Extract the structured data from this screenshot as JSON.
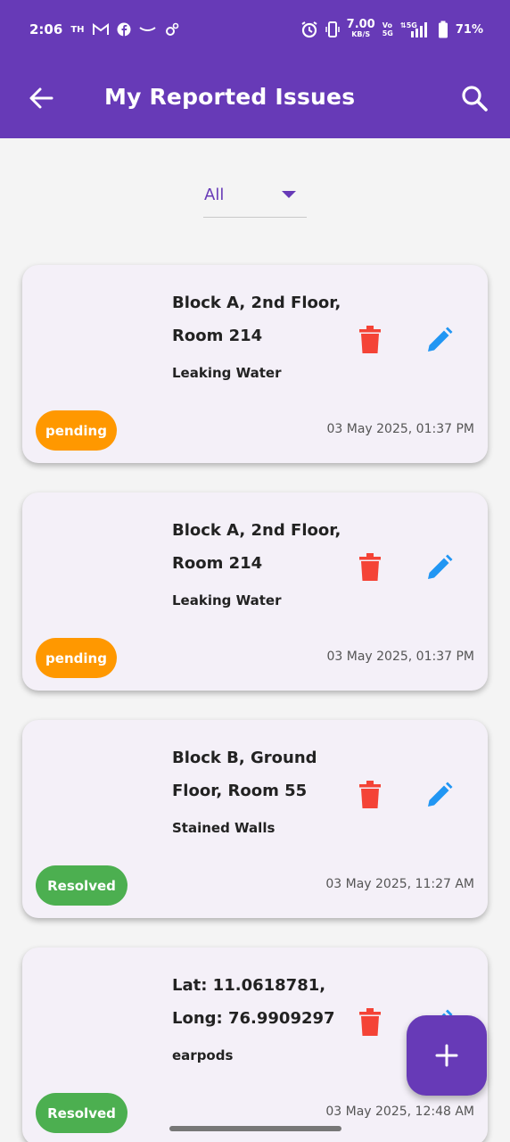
{
  "status_bar": {
    "time": "2:06",
    "carrier_tag": "TH",
    "net_speed": "7.00",
    "net_speed_unit": "KB/S",
    "volte_top": "Vo",
    "volte_bottom": "5G",
    "network_type": "5G",
    "battery": "71%"
  },
  "app_bar": {
    "title": "My Reported Issues",
    "back_icon": "arrow-left-icon",
    "search_icon": "search-icon"
  },
  "filter": {
    "selected": "All"
  },
  "colors": {
    "primary": "#673ab7",
    "pending": "#ff9800",
    "resolved": "#4caf50",
    "delete": "#f44336",
    "edit": "#2196f3"
  },
  "issues": [
    {
      "title": "Block A, 2nd Floor, Room 214",
      "description": "Leaking Water",
      "status": "pending",
      "date": "03 May 2025, 01:37 PM"
    },
    {
      "title": "Block A, 2nd Floor, Room 214",
      "description": "Leaking Water",
      "status": "pending",
      "date": "03 May 2025, 01:37 PM"
    },
    {
      "title": "Block B, Ground Floor, Room 55",
      "description": "Stained Walls",
      "status": "Resolved",
      "date": "03 May 2025, 11:27 AM"
    },
    {
      "title": "Lat: 11.0618781, Long: 76.9909297",
      "description": "earpods",
      "status": "Resolved",
      "date": "03 May 2025, 12:48 AM"
    }
  ]
}
